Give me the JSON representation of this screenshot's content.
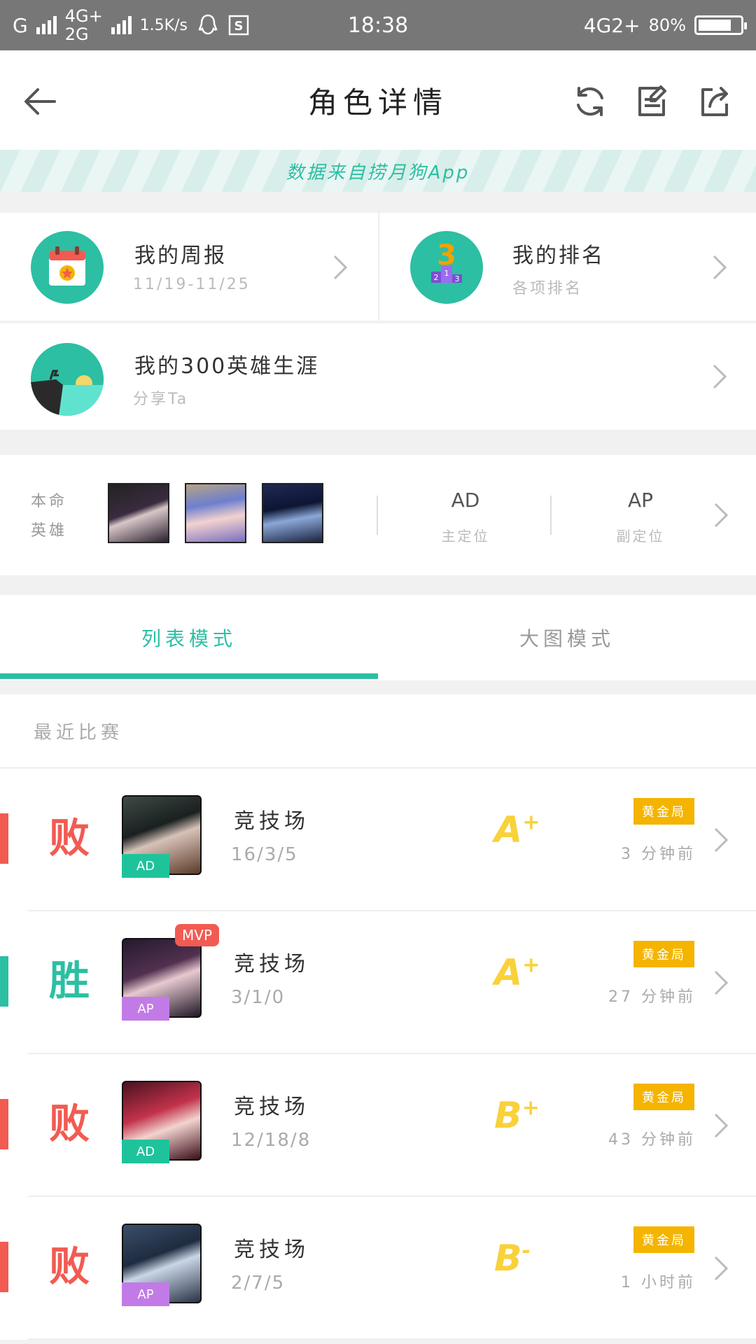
{
  "status_bar": {
    "carrier1": "G",
    "carrier2_top": "4G+",
    "carrier2_bottom": "2G",
    "speed": "1.5K/s",
    "time": "18:38",
    "network": "4G2+",
    "battery": "80%",
    "battery_level": 0.8
  },
  "header": {
    "title": "角色详情"
  },
  "banner": {
    "text": "数据来自捞月狗App"
  },
  "features": {
    "weekly": {
      "title": "我的周报",
      "sub": "11/19-11/25"
    },
    "ranking": {
      "title": "我的排名",
      "sub": "各项排名"
    },
    "career": {
      "title": "我的300英雄生涯",
      "sub": "分享Ta"
    }
  },
  "heroes": {
    "label_line1": "本命",
    "label_line2": "英雄",
    "main_pos_value": "AD",
    "main_pos_label": "主定位",
    "sub_pos_value": "AP",
    "sub_pos_label": "副定位"
  },
  "tabs": {
    "list": "列表模式",
    "big": "大图模式"
  },
  "recent": {
    "label": "最近比赛"
  },
  "matches": [
    {
      "result": "败",
      "mode": "竞技场",
      "kda": "16/3/5",
      "grade": "A",
      "grade_mod": "+",
      "badge": "黄金局",
      "time": "3 分钟前",
      "role": "AD",
      "mvp": ""
    },
    {
      "result": "胜",
      "mode": "竞技场",
      "kda": "3/1/0",
      "grade": "A",
      "grade_mod": "+",
      "badge": "黄金局",
      "time": "27 分钟前",
      "role": "AP",
      "mvp": "MVP"
    },
    {
      "result": "败",
      "mode": "竞技场",
      "kda": "12/18/8",
      "grade": "B",
      "grade_mod": "+",
      "badge": "黄金局",
      "time": "43 分钟前",
      "role": "AD",
      "mvp": ""
    },
    {
      "result": "败",
      "mode": "竞技场",
      "kda": "2/7/5",
      "grade": "B",
      "grade_mod": "-",
      "badge": "黄金局",
      "time": "1 小时前",
      "role": "AP",
      "mvp": ""
    }
  ],
  "colors": {
    "accent": "#2cbfa3",
    "loss": "#f25b52",
    "win": "#2cbfa3",
    "grade": "#f9d13a",
    "badge": "#f4b400",
    "role_ad": "#1fc39b",
    "role_ap": "#c27be6"
  }
}
